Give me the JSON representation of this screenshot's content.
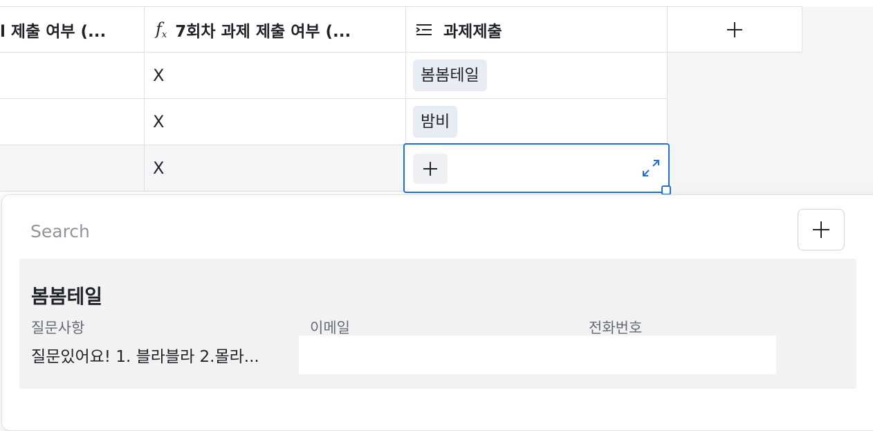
{
  "table": {
    "columns": [
      {
        "label": "l 제출 여부 (...",
        "icon": "none"
      },
      {
        "label": "7회차 과제 제출 여부 (...",
        "icon": "formula-icon"
      },
      {
        "label": "과제제출",
        "icon": "link-field-icon"
      },
      {
        "label": "",
        "icon": "plus-icon"
      }
    ],
    "rows": [
      {
        "col1": "",
        "col2": "X",
        "tag": "봄봄테일"
      },
      {
        "col1": "",
        "col2": "X",
        "tag": "밤비"
      },
      {
        "col1": "",
        "col2": "X",
        "tag": ""
      }
    ]
  },
  "popup": {
    "search_placeholder": "Search",
    "add_icon": "plus-icon",
    "record": {
      "title": "봄봄테일",
      "fields": [
        {
          "label": "질문사항",
          "value": "질문있어요! 1. 블라블라 2.몰라..."
        },
        {
          "label": "이메일",
          "value": ""
        },
        {
          "label": "전화번호",
          "value": ""
        }
      ]
    }
  },
  "colors": {
    "accent": "#1f6fd6",
    "tag_bg": "#e8ecf5",
    "record_bg": "#f2f2f2"
  }
}
